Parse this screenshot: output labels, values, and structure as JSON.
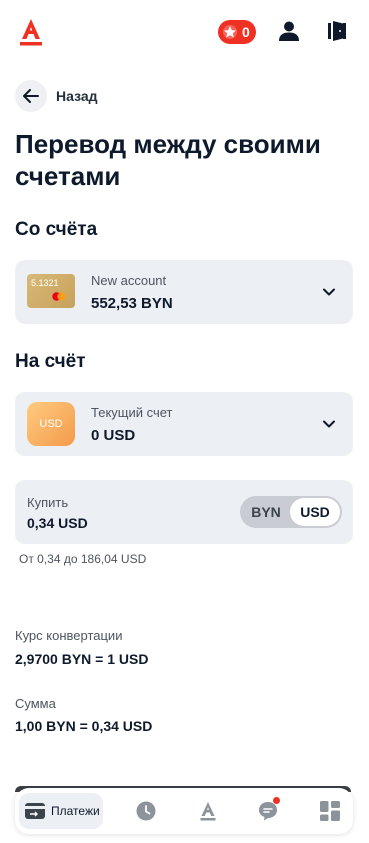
{
  "header": {
    "promo_count": "0",
    "colors": {
      "brand": "#ef3124"
    }
  },
  "nav": {
    "back_label": "Назад"
  },
  "page": {
    "title": "Перевод между своими счетами"
  },
  "from": {
    "section_title": "Со счёта",
    "card_number": "5.1321",
    "account_name": "New account",
    "balance": "552,53 BYN"
  },
  "to": {
    "section_title": "На счёт",
    "thumb_label": "USD",
    "account_name": "Текущий счет",
    "balance": "0 USD"
  },
  "buy": {
    "label": "Купить",
    "value": "0,34 USD",
    "currency_options": [
      "BYN",
      "USD"
    ],
    "selected_currency": "USD",
    "range_hint": "От 0,34 до 186,04 USD"
  },
  "rate": {
    "label": "Курс конвертации",
    "value": "2,9700 BYN = 1 USD"
  },
  "amount": {
    "label": "Сумма",
    "value": "1,00 BYN = 0,34 USD"
  },
  "tabbar": {
    "items": [
      {
        "label": "Платежи",
        "icon": "payments-icon",
        "active": true
      },
      {
        "label": "",
        "icon": "history-clock-icon"
      },
      {
        "label": "",
        "icon": "alfa-logo-icon"
      },
      {
        "label": "",
        "icon": "chat-icon",
        "badge": true
      },
      {
        "label": "",
        "icon": "products-grid-icon"
      }
    ]
  }
}
